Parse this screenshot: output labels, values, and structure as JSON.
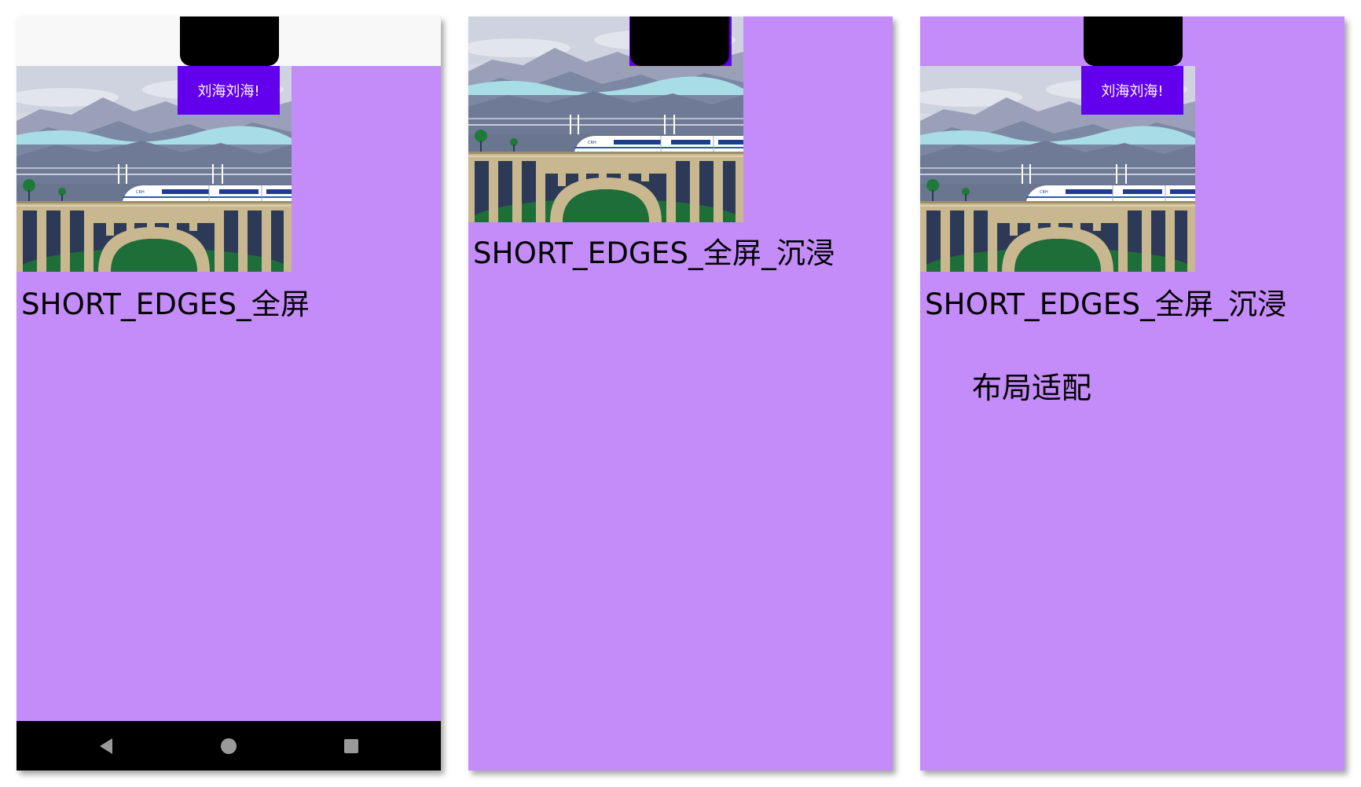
{
  "screens": [
    {
      "notch_button_label": "刘海刘海!",
      "mode_title": "SHORT_EDGES_全屏",
      "has_status_bar": true,
      "has_nav_bar": true
    },
    {
      "notch_button_label": "",
      "mode_title": "SHORT_EDGES_全屏_沉浸",
      "has_status_bar": false,
      "has_nav_bar": false
    },
    {
      "notch_button_label": "刘海刘海!",
      "mode_title": "SHORT_EDGES_全屏_沉浸",
      "layout_label": "布局适配",
      "has_status_bar": false,
      "has_nav_bar": false
    }
  ],
  "colors": {
    "screen_background": "#c48cf8",
    "notch_button": "#6200ee",
    "notch": "#000000",
    "status_bar": "#f8f8f8",
    "nav_bar": "#000000"
  },
  "icons": {
    "nav_back": "back-triangle-icon",
    "nav_home": "home-circle-icon",
    "nav_recent": "recents-square-icon",
    "banner": "train-bridge-illustration"
  }
}
